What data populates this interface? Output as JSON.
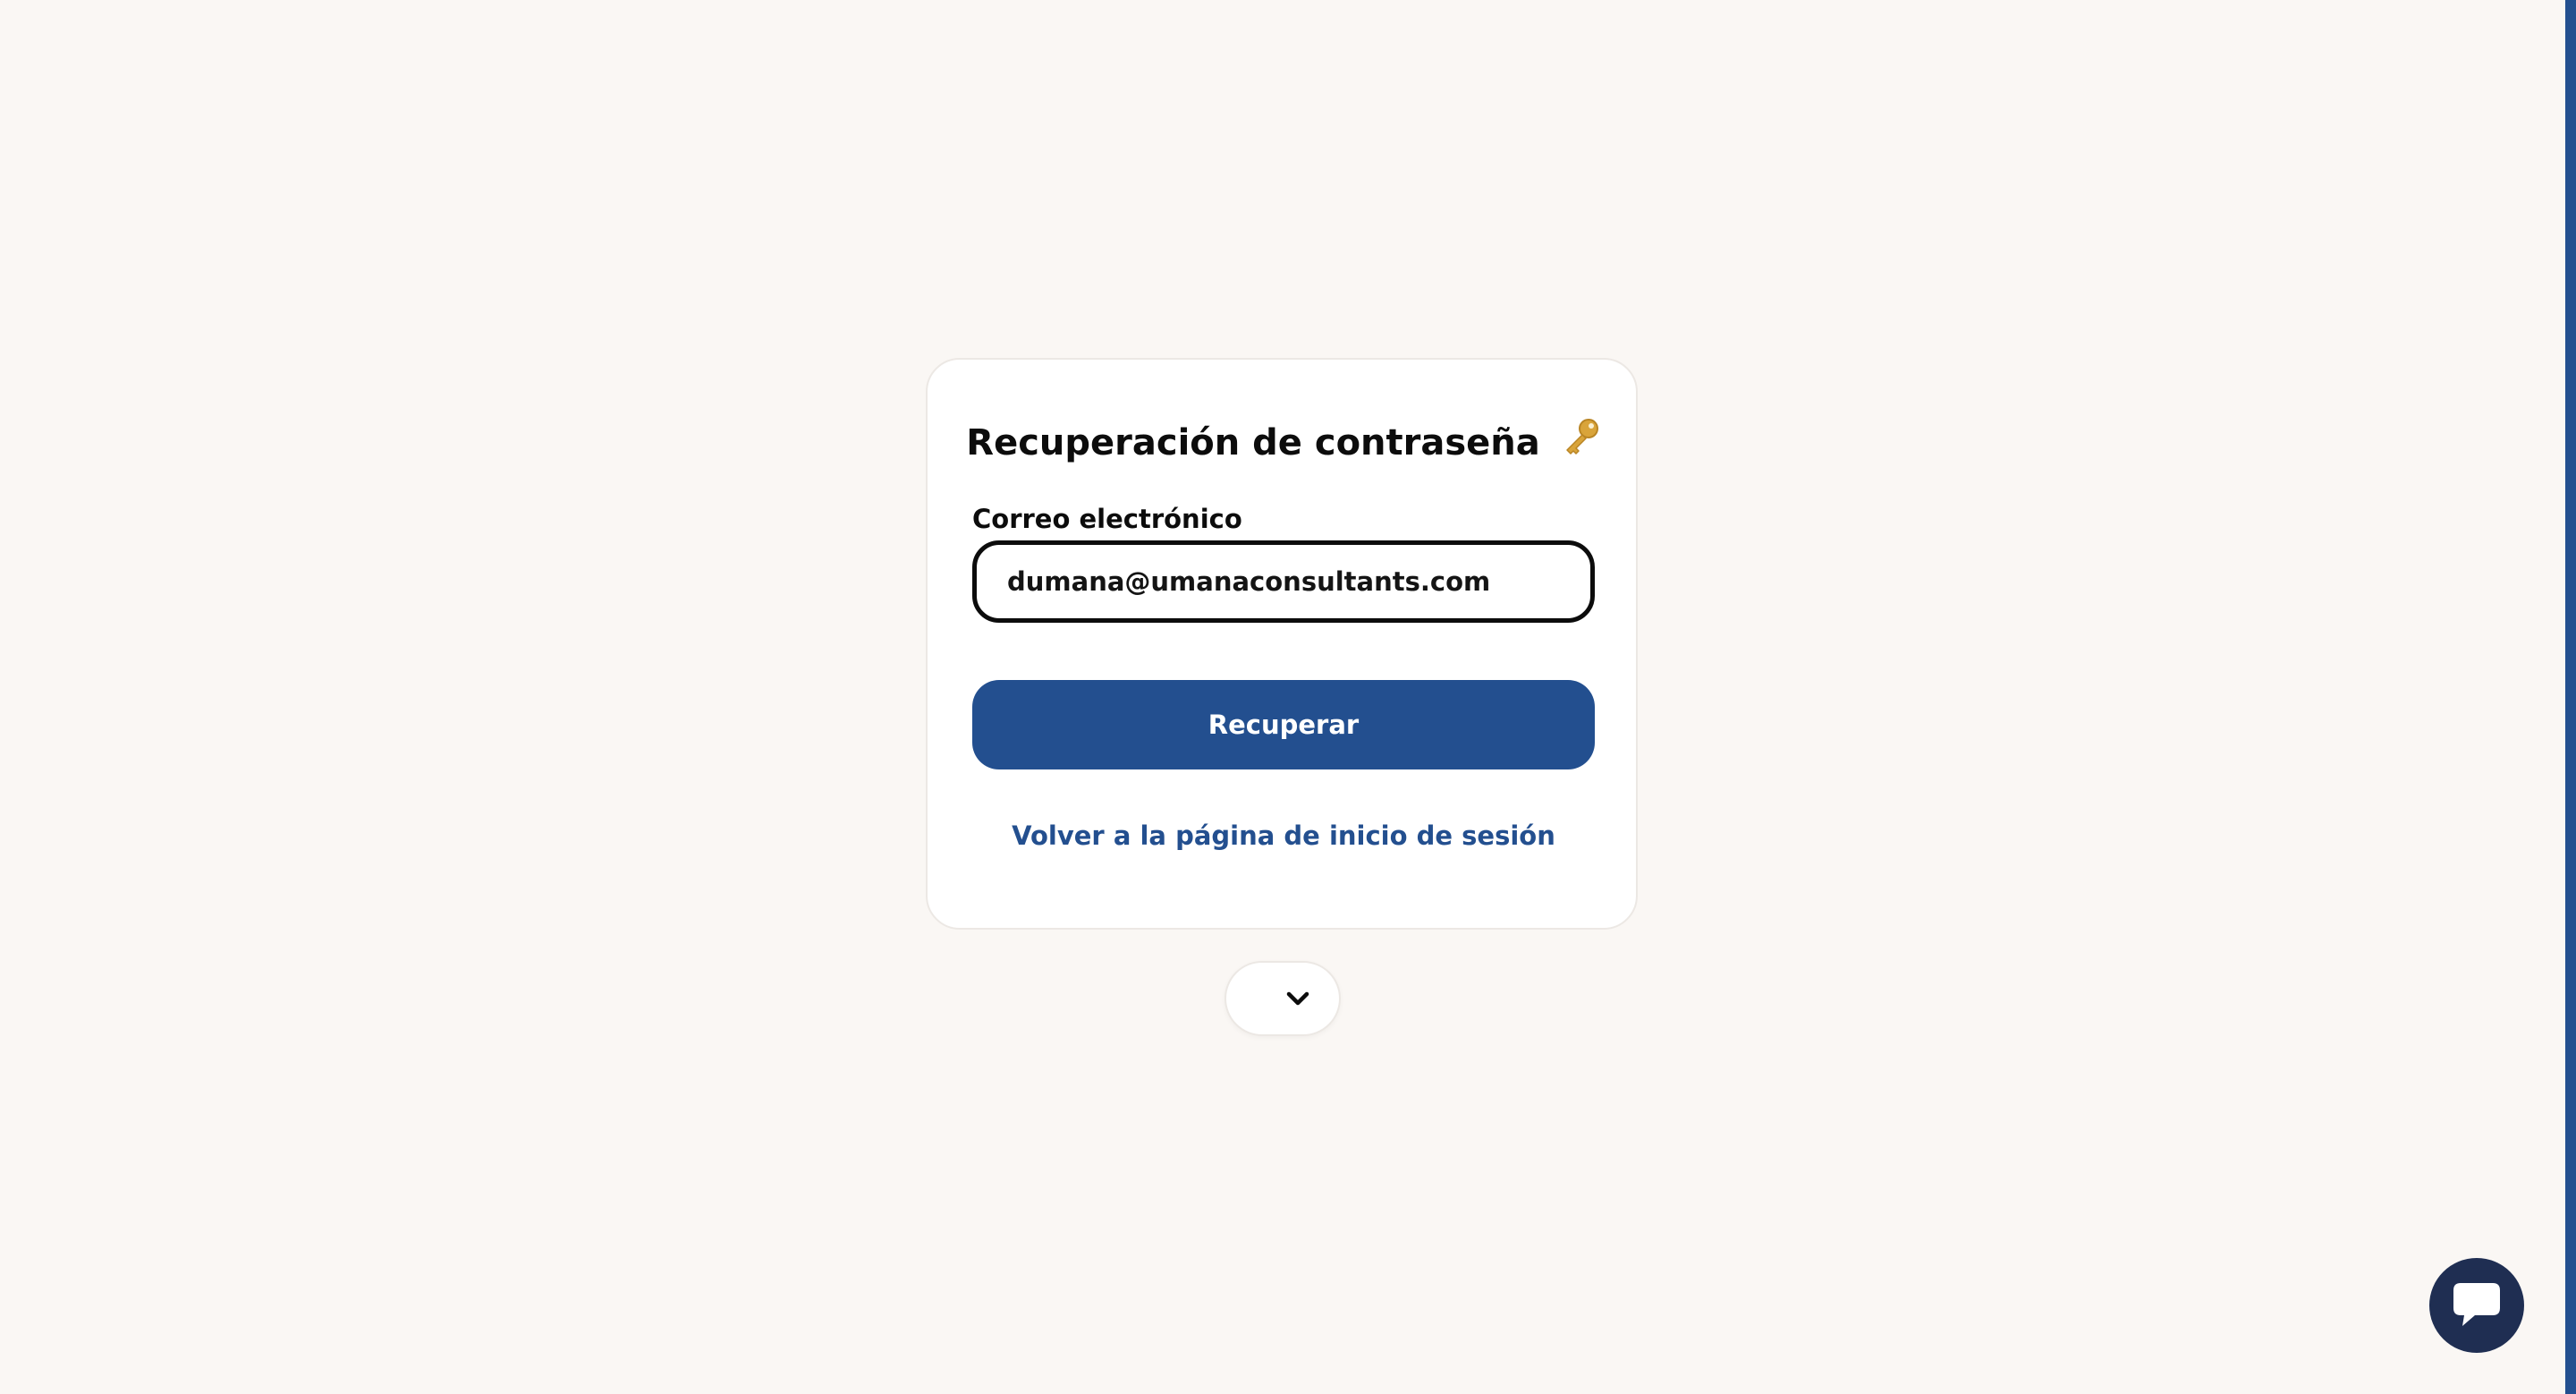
{
  "card": {
    "title": "Recuperación de contraseña",
    "title_icon": "key-icon",
    "email_label": "Correo electrónico",
    "email_value": "dumana@umanaconsultants.com",
    "recover_button_label": "Recuperar",
    "back_link_label": "Volver a la página de inicio de sesión"
  },
  "expand_button": {
    "icon": "chevron-down-icon"
  },
  "chat_widget": {
    "icon": "chat-bubble-icon"
  },
  "colors": {
    "background": "#faf7f4",
    "primary": "#234f8f",
    "chat": "#1f2e52",
    "text": "#0c0c0c"
  }
}
